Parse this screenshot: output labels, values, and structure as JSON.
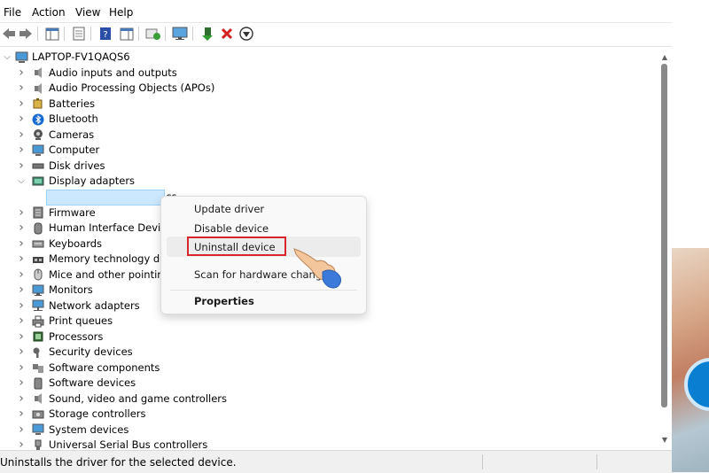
{
  "menu": [
    "File",
    "Action",
    "View",
    "Help"
  ],
  "toolbar_icons": [
    "back-arrow-icon",
    "forward-arrow-icon",
    "show-hide-console-tree-icon",
    "properties-page-icon",
    "help-icon",
    "action-pane-icon",
    "update-driver-icon",
    "monitor-icon",
    "add-legacy-hardware-icon",
    "uninstall-device-icon",
    "download-icon"
  ],
  "tree": {
    "root": "LAPTOP-FV1QAQS6",
    "items": [
      {
        "label": "Audio inputs and outputs",
        "icon": "speaker-icon"
      },
      {
        "label": "Audio Processing Objects (APOs)",
        "icon": "speaker-icon"
      },
      {
        "label": "Batteries",
        "icon": "battery-icon"
      },
      {
        "label": "Bluetooth",
        "icon": "bluetooth-icon"
      },
      {
        "label": "Cameras",
        "icon": "camera-icon"
      },
      {
        "label": "Computer",
        "icon": "computer-icon"
      },
      {
        "label": "Disk drives",
        "icon": "disk-drive-icon"
      },
      {
        "label": "Display adapters",
        "icon": "display-adapter-icon"
      },
      {
        "label": "Intel(R) UHD Graphics",
        "icon": "display-adapter-icon"
      },
      {
        "label": "Firmware",
        "icon": "firmware-icon"
      },
      {
        "label": "Human Interface Devices",
        "icon": "hid-icon"
      },
      {
        "label": "Keyboards",
        "icon": "keyboard-icon"
      },
      {
        "label": "Memory technology dev",
        "icon": "memory-icon"
      },
      {
        "label": "Mice and other pointing",
        "icon": "mouse-icon"
      },
      {
        "label": "Monitors",
        "icon": "monitor-icon"
      },
      {
        "label": "Network adapters",
        "icon": "network-icon"
      },
      {
        "label": "Print queues",
        "icon": "printer-icon"
      },
      {
        "label": "Processors",
        "icon": "processor-icon"
      },
      {
        "label": "Security devices",
        "icon": "security-key-icon"
      },
      {
        "label": "Software components",
        "icon": "puzzle-icon"
      },
      {
        "label": "Software devices",
        "icon": "phone-device-icon"
      },
      {
        "label": "Sound, video and game controllers",
        "icon": "speaker-icon"
      },
      {
        "label": "Storage controllers",
        "icon": "storage-controller-icon"
      },
      {
        "label": "System devices",
        "icon": "system-device-icon"
      },
      {
        "label": "Universal Serial Bus controllers",
        "icon": "usb-icon"
      }
    ]
  },
  "context_menu": {
    "items": [
      "Update driver",
      "Disable device",
      "Uninstall device",
      "Scan for hardware changes",
      "Properties"
    ]
  },
  "status": "Uninstalls the driver for the selected device.",
  "colors": {
    "highlight_border": "#d9262c",
    "selection": "#cce8ff",
    "accent_blue": "#0a7fd1"
  }
}
